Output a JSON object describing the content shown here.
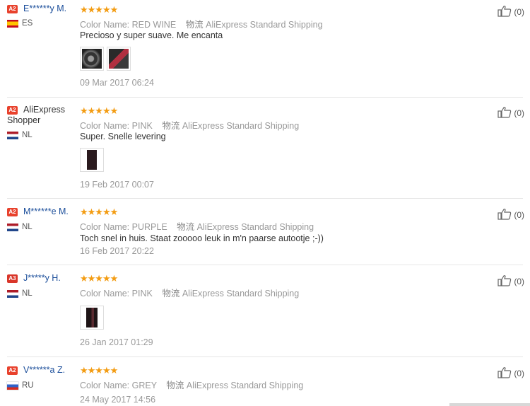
{
  "reviews": [
    {
      "user": "E******y M.",
      "level": "A2",
      "country": "ES",
      "color_label": "Color Name:",
      "color": "RED WINE",
      "logistics_cn": "物流",
      "shipping": "AliExpress Standard Shipping",
      "comment": "Precioso y super suave. Me encanta",
      "date": "09 Mar 2017 06:24",
      "helpful": "(0)"
    },
    {
      "user": "AliExpress Shopper",
      "level": "A2",
      "country": "NL",
      "color_label": "Color Name:",
      "color": "PINK",
      "logistics_cn": "物流",
      "shipping": "AliExpress Standard Shipping",
      "comment": "Super. Snelle levering",
      "date": "19 Feb 2017 00:07",
      "helpful": "(0)"
    },
    {
      "user": "M******e M.",
      "level": "A2",
      "country": "NL",
      "color_label": "Color Name:",
      "color": "PURPLE",
      "logistics_cn": "物流",
      "shipping": "AliExpress Standard Shipping",
      "comment": "Toch snel in huis. Staat zooooo leuk in m'n paarse autootje ;-))",
      "date": "16 Feb 2017 20:22",
      "helpful": "(0)"
    },
    {
      "user": "J*****y H.",
      "level": "A3",
      "country": "NL",
      "color_label": "Color Name:",
      "color": "PINK",
      "logistics_cn": "物流",
      "shipping": "AliExpress Standard Shipping",
      "comment": "",
      "date": "26 Jan 2017 01:29",
      "helpful": "(0)"
    },
    {
      "user": "V******a Z.",
      "level": "A2",
      "country": "RU",
      "color_label": "Color Name:",
      "color": "GREY",
      "logistics_cn": "物流",
      "shipping": "AliExpress Standard Shipping",
      "comment": "",
      "date": "24 May 2017 14:56",
      "helpful": "(0)"
    }
  ],
  "stars": "★★★★★",
  "icons": {
    "thumbs_up": "thumbs-up-icon",
    "photo": "review-photo"
  },
  "colors": {
    "star": "#f39c12",
    "badge": "#e8412c",
    "username": "#1a4d9a",
    "muted": "#999999"
  }
}
